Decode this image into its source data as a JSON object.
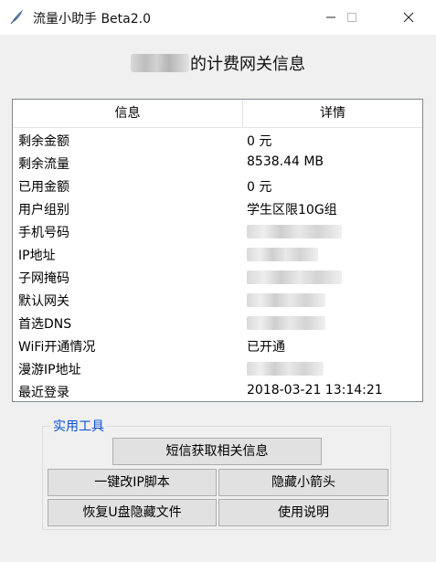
{
  "window": {
    "title": "流量小助手 Beta2.0",
    "icons": [
      "feather-icon",
      "minimize-icon",
      "maximize-icon",
      "close-icon"
    ]
  },
  "header": {
    "title_suffix": "的计费网关信息"
  },
  "table": {
    "columns": [
      "信息",
      "详情"
    ],
    "rows": [
      {
        "key": "剩余金额",
        "value": "0 元"
      },
      {
        "key": "剩余流量",
        "value": "8538.44 MB"
      },
      {
        "key": "已用金额",
        "value": "0 元"
      },
      {
        "key": "用户组别",
        "value": "学生区限10G组"
      },
      {
        "key": "手机号码",
        "value": null
      },
      {
        "key": "IP地址",
        "value": null
      },
      {
        "key": "子网掩码",
        "value": null
      },
      {
        "key": "默认网关",
        "value": null
      },
      {
        "key": "首选DNS",
        "value": null
      },
      {
        "key": "WiFi开通情况",
        "value": "已开通"
      },
      {
        "key": "漫游IP地址",
        "value": null
      },
      {
        "key": "最近登录",
        "value": "2018-03-21 13:14:21"
      }
    ]
  },
  "tools": {
    "label": "实用工具",
    "sms_button": "短信获取相关信息",
    "change_ip_button": "一键改IP脚本",
    "hide_arrow_button": "隐藏小箭头",
    "restore_usb_button": "恢复U盘隐藏文件",
    "help_button": "使用说明"
  },
  "colors": {
    "group_label": "#0b4fd6",
    "window_bg": "#f0f0f0",
    "button_bg": "#e1e1e1"
  }
}
